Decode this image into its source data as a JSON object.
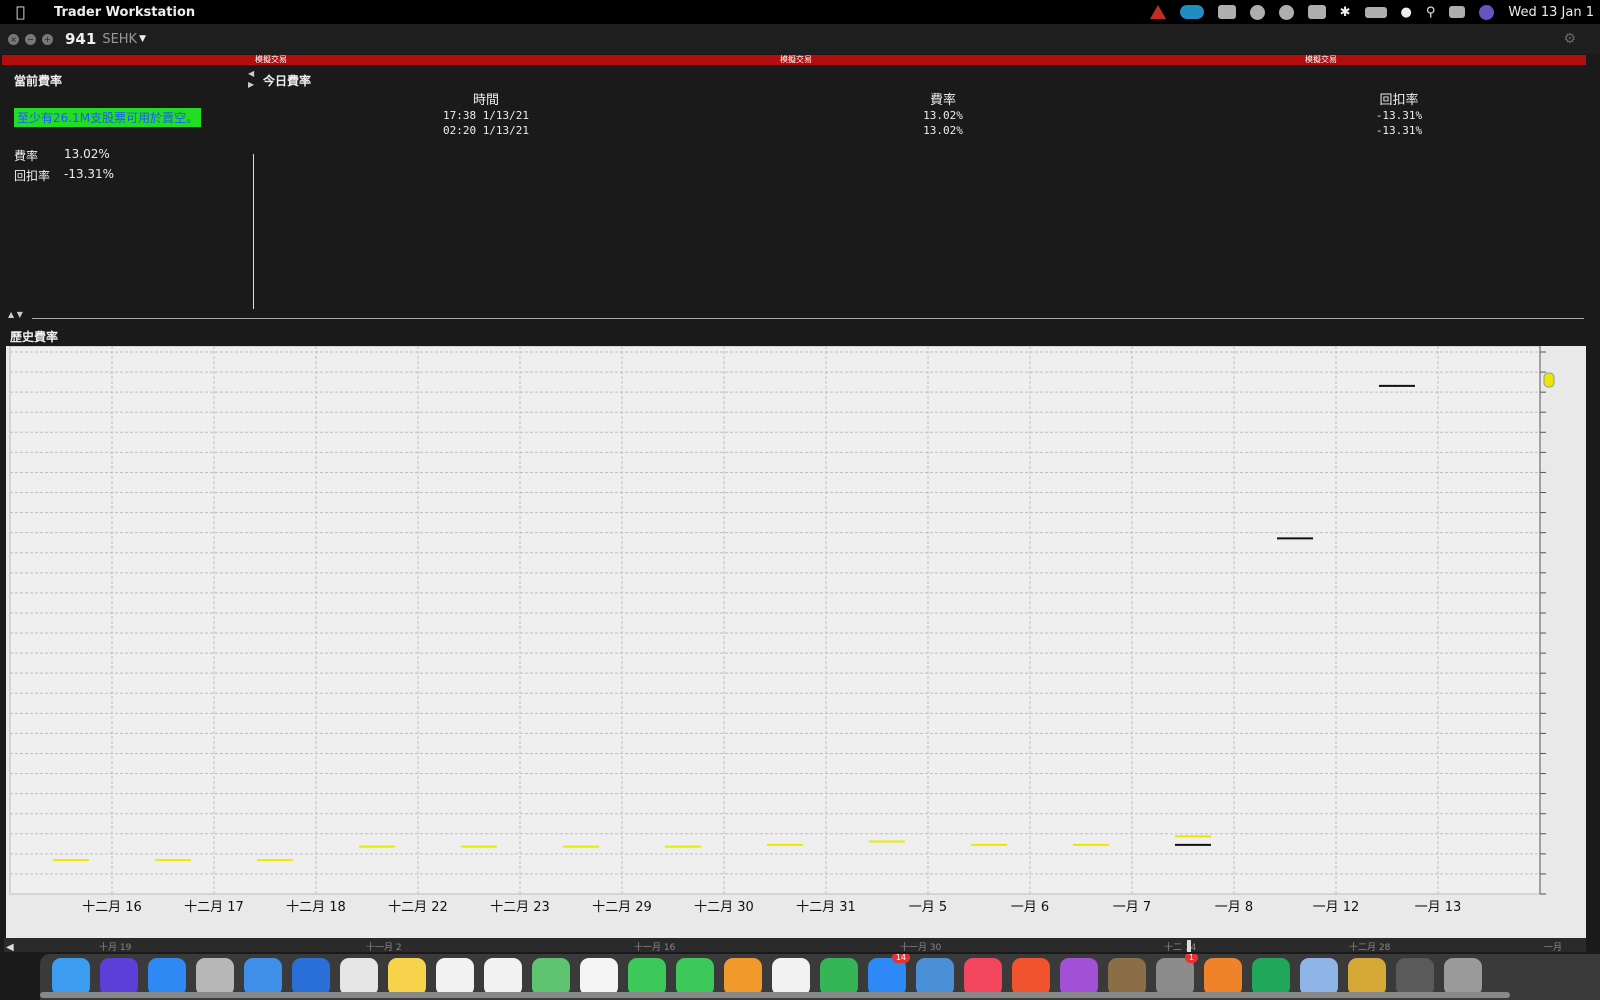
{
  "menubar": {
    "app_name": "Trader Workstation",
    "clock": "Wed 13 Jan  1",
    "icons": [
      "apple-icon",
      "warning-icon",
      "vpn-icon",
      "record-icon",
      "shazam-icon",
      "play-icon",
      "clipboard-icon",
      "bluetooth-icon",
      "battery-icon",
      "wifi-icon",
      "search-icon",
      "control-center-icon",
      "siri-icon"
    ]
  },
  "window": {
    "symbol": "941",
    "exchange": "SEHK",
    "sim_label": "模擬交易"
  },
  "current": {
    "title": "當前費率",
    "availability": "至少有26.1M支股票可用於賣空。",
    "fee_label": "費率",
    "fee_value": "13.02%",
    "rebate_label": "回扣率",
    "rebate_value": "-13.31%"
  },
  "today": {
    "title": "今日費率",
    "headers": [
      "時間",
      "費率",
      "回扣率"
    ],
    "rows": [
      {
        "time": "17:38  1/13/21",
        "fee": "13.02%",
        "rebate": "-13.31%"
      },
      {
        "time": "02:20  1/13/21",
        "fee": "13.02%",
        "rebate": "-13.31%"
      }
    ]
  },
  "history": {
    "title": "歷史費率"
  },
  "chart_data": {
    "type": "line",
    "categories": [
      "十二月 16",
      "十二月 17",
      "十二月 18",
      "十二月 22",
      "十二月 23",
      "十二月 29",
      "十二月 30",
      "十二月 31",
      "一月 5",
      "一月 6",
      "一月 7",
      "一月 8",
      "一月 12",
      "一月 13"
    ],
    "series": [
      {
        "color": "#e8e800",
        "values": [
          1.0,
          1.0,
          1.0,
          1.4,
          1.4,
          1.4,
          1.4,
          1.45,
          1.55,
          1.45,
          1.45,
          1.7,
          null,
          null
        ]
      },
      {
        "color": "#111111",
        "values": [
          null,
          null,
          null,
          null,
          null,
          null,
          null,
          null,
          null,
          null,
          null,
          1.45,
          10.5,
          15.0
        ]
      }
    ],
    "navigator_labels": [
      "十月 19",
      "十一月 2",
      "十一月 16",
      "十一月 30",
      "十二 14",
      "十二月 28",
      "一月"
    ],
    "grid": true
  },
  "dock": {
    "apps": [
      {
        "name": "finder",
        "color": "#3b9cf0"
      },
      {
        "name": "siri",
        "color": "#5b3fd6"
      },
      {
        "name": "safari",
        "color": "#2f89f5"
      },
      {
        "name": "launchpad",
        "color": "#b7b7b7"
      },
      {
        "name": "mail",
        "color": "#3f8fe9"
      },
      {
        "name": "airdrop",
        "color": "#2a6fd8"
      },
      {
        "name": "chrome",
        "color": "#e6e6e6"
      },
      {
        "name": "notes",
        "color": "#f6d34b"
      },
      {
        "name": "calendar",
        "color": "#f2f2f2"
      },
      {
        "name": "reminders",
        "color": "#f2f2f2"
      },
      {
        "name": "maps",
        "color": "#5ec46f"
      },
      {
        "name": "photos",
        "color": "#f5f5f5"
      },
      {
        "name": "facetime",
        "color": "#3cc95a"
      },
      {
        "name": "messages",
        "color": "#3cc95a"
      },
      {
        "name": "keynote",
        "color": "#f19a2c"
      },
      {
        "name": "acrobat",
        "color": "#f2f2f2"
      },
      {
        "name": "numbers",
        "color": "#34b556"
      },
      {
        "name": "app-store",
        "color": "#2d89f5",
        "badge": "14"
      },
      {
        "name": "preview",
        "color": "#4a90d9"
      },
      {
        "name": "music",
        "color": "#f2465d"
      },
      {
        "name": "brave",
        "color": "#f0532d"
      },
      {
        "name": "podcasts",
        "color": "#a251d6"
      },
      {
        "name": "utility",
        "color": "#8a6e45"
      },
      {
        "name": "system-preferences",
        "color": "#8c8c8c",
        "badge": "1"
      },
      {
        "name": "crypto-app",
        "color": "#f0832a"
      },
      {
        "name": "evernote",
        "color": "#1fa85a"
      },
      {
        "name": "screen-app",
        "color": "#8fb5e6"
      },
      {
        "name": "coins",
        "color": "#d6a838"
      },
      {
        "name": "window",
        "color": "#5a5a5a"
      },
      {
        "name": "trash",
        "color": "#9a9a9a"
      }
    ]
  }
}
